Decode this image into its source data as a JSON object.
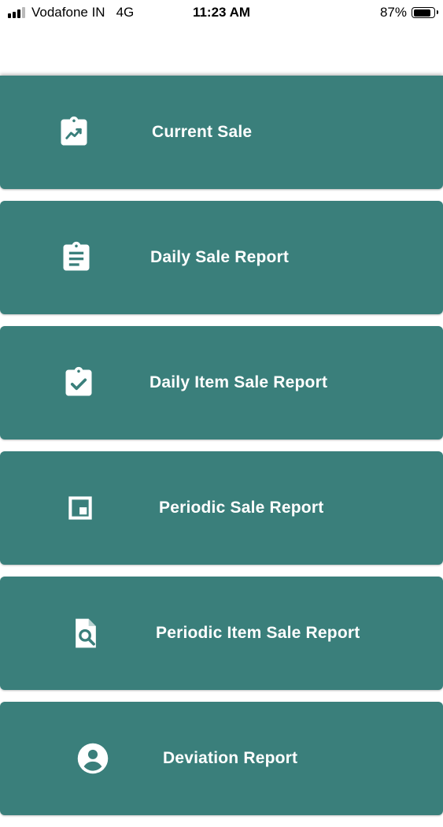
{
  "status_bar": {
    "carrier": "Vodafone IN",
    "network": "4G",
    "time": "11:23 AM",
    "battery_percent": "87%",
    "battery_level": 0.87
  },
  "menu": {
    "items": [
      {
        "label": "Current Sale",
        "icon": "clipboard-trend-icon"
      },
      {
        "label": "Daily Sale Report",
        "icon": "clipboard-list-icon"
      },
      {
        "label": "Daily Item Sale Report",
        "icon": "clipboard-check-icon"
      },
      {
        "label": "Periodic Sale Report",
        "icon": "picture-in-picture-icon"
      },
      {
        "label": "Periodic Item Sale Report",
        "icon": "document-search-icon"
      },
      {
        "label": "Deviation Report",
        "icon": "account-circle-icon"
      }
    ]
  },
  "colors": {
    "card_background": "#3a7f7b",
    "card_text": "#ffffff"
  }
}
